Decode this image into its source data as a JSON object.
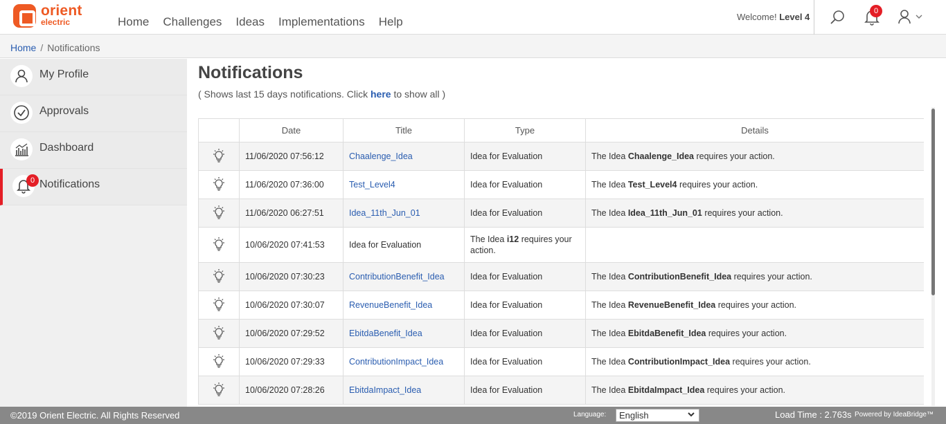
{
  "brand": {
    "name": "orient",
    "sub": "electric"
  },
  "nav": [
    "Home",
    "Challenges",
    "Ideas",
    "Implementations",
    "Help"
  ],
  "header": {
    "welcome_prefix": "Welcome!",
    "user_level": "Level 4",
    "notification_count": "0"
  },
  "breadcrumb": {
    "home": "Home",
    "separator": "/",
    "current": "Notifications"
  },
  "sidebar": {
    "items": [
      {
        "label": "My Profile",
        "icon": "user-icon"
      },
      {
        "label": "Approvals",
        "icon": "check-circle-icon"
      },
      {
        "label": "Dashboard",
        "icon": "bar-chart-icon"
      },
      {
        "label": "Notifications",
        "icon": "bell-icon",
        "badge": "0",
        "active": true
      }
    ]
  },
  "page": {
    "title": "Notifications",
    "subtitle_before": "( Shows last 15 days notifications. Click ",
    "subtitle_link": "here",
    "subtitle_after": " to show all )"
  },
  "table": {
    "headers": [
      "",
      "Date",
      "Title",
      "Type",
      "Details"
    ],
    "rows": [
      {
        "date": "11/06/2020 07:56:12",
        "title": "Chaalenge_Idea",
        "type": "Idea for Evaluation",
        "details_pre": "The Idea ",
        "details_bold": "Chaalenge_Idea",
        "details_post": " requires your action."
      },
      {
        "date": "11/06/2020 07:36:00",
        "title": "Test_Level4",
        "type": "Idea for Evaluation",
        "details_pre": "The Idea ",
        "details_bold": "Test_Level4",
        "details_post": " requires your action."
      },
      {
        "date": "11/06/2020 06:27:51",
        "title": "Idea_11th_Jun_01",
        "type": "Idea for Evaluation",
        "details_pre": "The Idea ",
        "details_bold": "Idea_11th_Jun_01",
        "details_post": " requires your action."
      },
      {
        "date": "10/06/2020 07:41:53",
        "title": "Idea for Evaluation",
        "type_pre": "The Idea ",
        "type_bold": "i12",
        "type_post": " requires your action.",
        "details": ""
      },
      {
        "date": "10/06/2020 07:30:23",
        "title": "ContributionBenefit_Idea",
        "type": "Idea for Evaluation",
        "details_pre": "The Idea ",
        "details_bold": "ContributionBenefit_Idea",
        "details_post": " requires your action."
      },
      {
        "date": "10/06/2020 07:30:07",
        "title": "RevenueBenefit_Idea",
        "type": "Idea for Evaluation",
        "details_pre": "The Idea ",
        "details_bold": "RevenueBenefit_Idea",
        "details_post": " requires your action."
      },
      {
        "date": "10/06/2020 07:29:52",
        "title": "EbitdaBenefit_Idea",
        "type": "Idea for Evaluation",
        "details_pre": "The Idea ",
        "details_bold": "EbitdaBenefit_Idea",
        "details_post": " requires your action."
      },
      {
        "date": "10/06/2020 07:29:33",
        "title": "ContributionImpact_Idea",
        "type": "Idea for Evaluation",
        "details_pre": "The Idea ",
        "details_bold": "ContributionImpact_Idea",
        "details_post": " requires your action."
      },
      {
        "date": "10/06/2020 07:28:26",
        "title": "EbitdaImpact_Idea",
        "type": "Idea for Evaluation",
        "details_pre": "The Idea ",
        "details_bold": "EbitdaImpact_Idea",
        "details_post": " requires your action."
      }
    ]
  },
  "footer": {
    "copyright": "©2019 Orient Electric. All Rights Reserved",
    "language_label": "Language:",
    "language_value": "English",
    "load_time": "Load Time : 2.763s",
    "powered_by": "Powered by IdeaBridge™"
  },
  "colors": {
    "brand_orange": "#ee5a24",
    "badge_red": "#e41e26",
    "link_blue": "#2a5db0",
    "footer_gray": "#888888"
  }
}
